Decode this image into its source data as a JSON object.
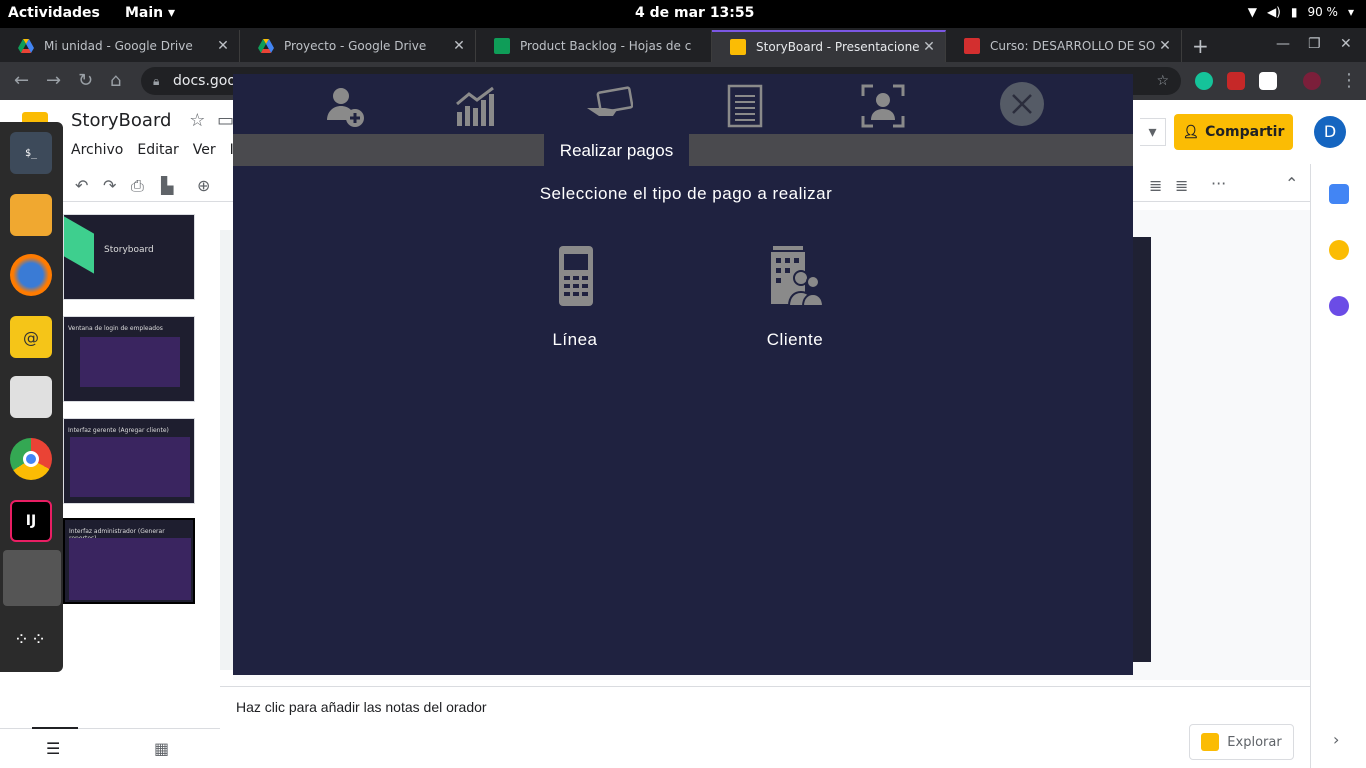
{
  "topbar": {
    "activities": "Actividades",
    "app_menu": "Main",
    "clock": "4 de mar  13:55",
    "battery": "90 %"
  },
  "tabs": [
    {
      "label": "Mi unidad - Google Drive",
      "icon": "google-drive-icon"
    },
    {
      "label": "Proyecto - Google Drive",
      "icon": "google-drive-icon"
    },
    {
      "label": "Product Backlog - Hojas de c",
      "icon": "google-sheets-icon"
    },
    {
      "label": "StoryBoard - Presentaciones",
      "icon": "google-slides-icon"
    },
    {
      "label": "Curso: DESARROLLO DE SOF",
      "icon": "course-icon"
    }
  ],
  "address_bar": {
    "url": "docs.goo"
  },
  "slides_app": {
    "title": "StoryBoard",
    "menu": [
      "Archivo",
      "Editar",
      "Ver",
      "In"
    ],
    "share_label": "Compartir",
    "avatar_letter": "D",
    "thumbnails": [
      {
        "label": "Storyboard"
      },
      {
        "label": "Ventana de login de empleados"
      },
      {
        "label": "Interfaz gerente (Agregar cliente)"
      },
      {
        "label": "Interfaz administrador (Generar reportes)"
      }
    ],
    "notes_placeholder": "Haz clic para añadir las notas del orador",
    "explore_label": "Explorar"
  },
  "overlay": {
    "tab_label": "Realizar pagos",
    "prompt": "Seleccione el tipo de pago a realizar",
    "options": [
      {
        "label": "Línea",
        "icon": "mobile-phone-icon"
      },
      {
        "label": "Cliente",
        "icon": "building-people-icon"
      }
    ],
    "top_icons": [
      "add-user-icon",
      "chart-growth-icon",
      "card-payment-icon",
      "receipt-icon",
      "user-scan-icon",
      "close-icon"
    ]
  },
  "colors": {
    "overlay_bg": "#1f2240",
    "overlay_bar": "#4a4a4e",
    "icon_gray": "#8a8a8a",
    "share_yellow": "#fbbc04",
    "chrome_dark": "#202124"
  }
}
